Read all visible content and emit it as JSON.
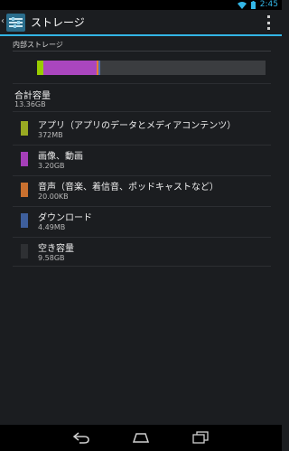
{
  "status_bar": {
    "time": "2:45"
  },
  "action_bar": {
    "title": "ストレージ"
  },
  "section": {
    "header": "内部ストレージ"
  },
  "storage_bar": {
    "segments": [
      {
        "name": "apps",
        "fraction": 0.027,
        "color": "#99cc00"
      },
      {
        "name": "pictures",
        "fraction": 0.234,
        "color": "#aa46be"
      },
      {
        "name": "audio",
        "fraction": 0.006,
        "color": "#e67e33"
      },
      {
        "name": "downloads",
        "fraction": 0.008,
        "color": "#4b70b4"
      },
      {
        "name": "free",
        "fraction": 0.725,
        "color": "#3b3d40"
      }
    ]
  },
  "total": {
    "label": "合計容量",
    "value": "13.36GB"
  },
  "categories": [
    {
      "label": "アプリ（アプリのデータとメディアコンテンツ）",
      "value": "372MB",
      "color": "#99aa22"
    },
    {
      "label": "画像、動画",
      "value": "3.20GB",
      "color": "#a53fb8"
    },
    {
      "label": "音声（音楽、着信音、ポッドキャストなど）",
      "value": "20.00KB",
      "color": "#c9702f"
    },
    {
      "label": "ダウンロード",
      "value": "4.49MB",
      "color": "#3e5f9c"
    },
    {
      "label": "空き容量",
      "value": "9.58GB",
      "color": "#2e3033"
    }
  ]
}
